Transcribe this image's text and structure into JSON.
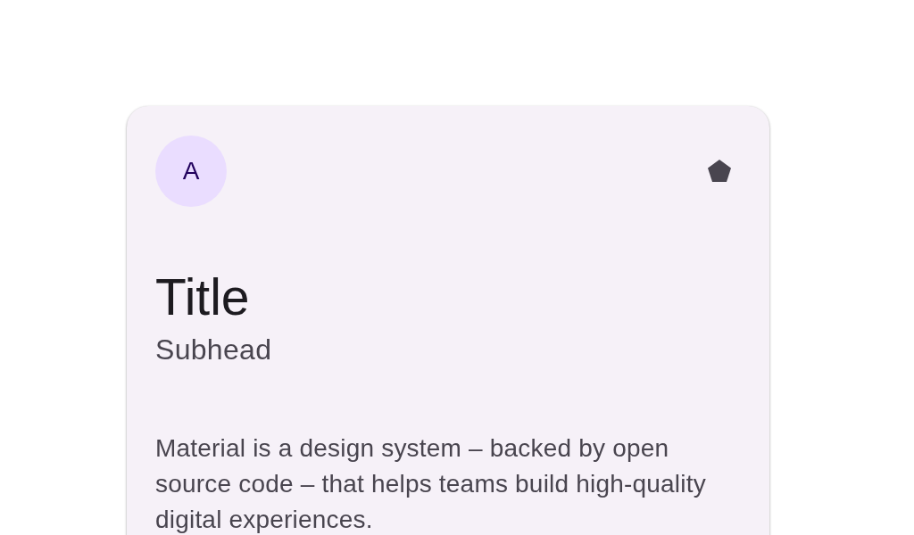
{
  "card": {
    "avatar": "A",
    "title": "Title",
    "subhead": "Subhead",
    "body": "Material is a design system – backed by open source code – that helps teams build high-quality digital experiences."
  }
}
